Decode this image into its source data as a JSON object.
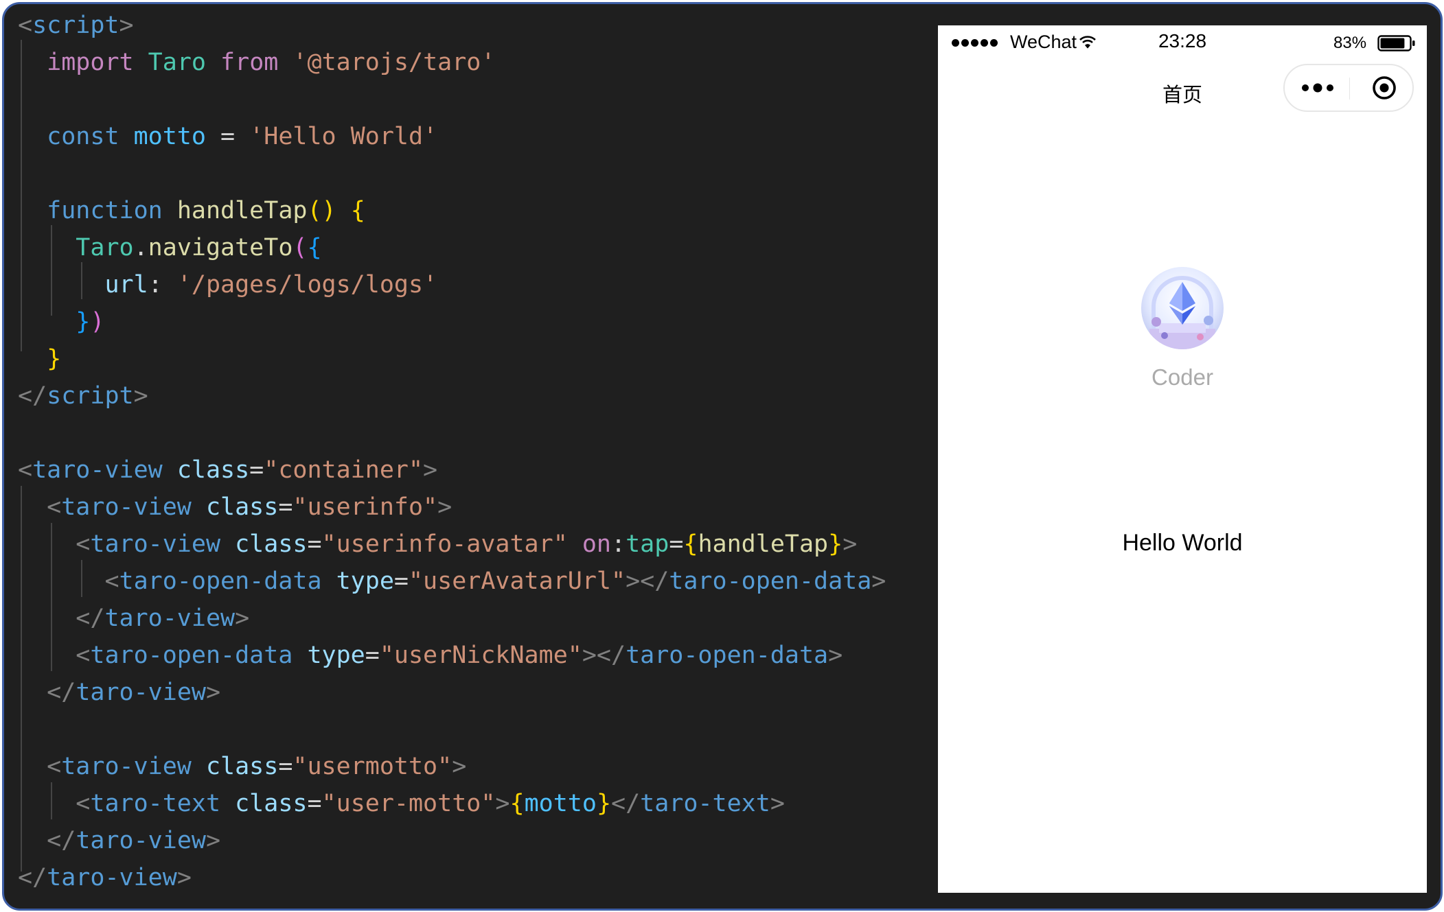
{
  "editor": {
    "lines": [
      [
        {
          "t": "<",
          "c": "t-tag"
        },
        {
          "t": "script",
          "c": "t-el"
        },
        {
          "t": ">",
          "c": "t-tag"
        }
      ],
      [
        {
          "t": "  "
        },
        {
          "t": "import",
          "c": "t-kw"
        },
        {
          "t": " "
        },
        {
          "t": "Taro",
          "c": "t-type"
        },
        {
          "t": " "
        },
        {
          "t": "from",
          "c": "t-kw"
        },
        {
          "t": " "
        },
        {
          "t": "'@tarojs/taro'",
          "c": "t-str"
        }
      ],
      [],
      [
        {
          "t": "  "
        },
        {
          "t": "const",
          "c": "t-decl"
        },
        {
          "t": " "
        },
        {
          "t": "motto",
          "c": "t-var"
        },
        {
          "t": " = ",
          "c": "t-plain"
        },
        {
          "t": "'Hello World'",
          "c": "t-str"
        }
      ],
      [],
      [
        {
          "t": "  "
        },
        {
          "t": "function",
          "c": "t-decl"
        },
        {
          "t": " "
        },
        {
          "t": "handleTap",
          "c": "t-fn"
        },
        {
          "t": "()",
          "c": "t-b1"
        },
        {
          "t": " "
        },
        {
          "t": "{",
          "c": "t-b1"
        }
      ],
      [
        {
          "t": "    "
        },
        {
          "t": "Taro",
          "c": "t-type"
        },
        {
          "t": ".",
          "c": "t-plain"
        },
        {
          "t": "navigateTo",
          "c": "t-fn"
        },
        {
          "t": "(",
          "c": "t-b2"
        },
        {
          "t": "{",
          "c": "t-b3"
        }
      ],
      [
        {
          "t": "      "
        },
        {
          "t": "url",
          "c": "t-prop"
        },
        {
          "t": ": ",
          "c": "t-plain"
        },
        {
          "t": "'/pages/logs/logs'",
          "c": "t-str"
        }
      ],
      [
        {
          "t": "    "
        },
        {
          "t": "}",
          "c": "t-b3"
        },
        {
          "t": ")",
          "c": "t-b2"
        }
      ],
      [
        {
          "t": "  "
        },
        {
          "t": "}",
          "c": "t-b1"
        }
      ],
      [
        {
          "t": "</",
          "c": "t-tag"
        },
        {
          "t": "script",
          "c": "t-el"
        },
        {
          "t": ">",
          "c": "t-tag"
        }
      ],
      [],
      [
        {
          "t": "<",
          "c": "t-tag"
        },
        {
          "t": "taro-view",
          "c": "t-el"
        },
        {
          "t": " "
        },
        {
          "t": "class",
          "c": "t-attr"
        },
        {
          "t": "=",
          "c": "t-plain"
        },
        {
          "t": "\"container\"",
          "c": "t-str"
        },
        {
          "t": ">",
          "c": "t-tag"
        }
      ],
      [
        {
          "t": "  "
        },
        {
          "t": "<",
          "c": "t-tag"
        },
        {
          "t": "taro-view",
          "c": "t-el"
        },
        {
          "t": " "
        },
        {
          "t": "class",
          "c": "t-attr"
        },
        {
          "t": "=",
          "c": "t-plain"
        },
        {
          "t": "\"userinfo\"",
          "c": "t-str"
        },
        {
          "t": ">",
          "c": "t-tag"
        }
      ],
      [
        {
          "t": "    "
        },
        {
          "t": "<",
          "c": "t-tag"
        },
        {
          "t": "taro-view",
          "c": "t-el"
        },
        {
          "t": " "
        },
        {
          "t": "class",
          "c": "t-attr"
        },
        {
          "t": "=",
          "c": "t-plain"
        },
        {
          "t": "\"userinfo-avatar\"",
          "c": "t-str"
        },
        {
          "t": " "
        },
        {
          "t": "on",
          "c": "t-kw"
        },
        {
          "t": ":",
          "c": "t-plain"
        },
        {
          "t": "tap",
          "c": "t-type"
        },
        {
          "t": "=",
          "c": "t-plain"
        },
        {
          "t": "{",
          "c": "t-b1"
        },
        {
          "t": "handleTap",
          "c": "t-fn"
        },
        {
          "t": "}",
          "c": "t-b1"
        },
        {
          "t": ">",
          "c": "t-tag"
        }
      ],
      [
        {
          "t": "      "
        },
        {
          "t": "<",
          "c": "t-tag"
        },
        {
          "t": "taro-open-data",
          "c": "t-el"
        },
        {
          "t": " "
        },
        {
          "t": "type",
          "c": "t-attr"
        },
        {
          "t": "=",
          "c": "t-plain"
        },
        {
          "t": "\"userAvatarUrl\"",
          "c": "t-str"
        },
        {
          "t": "></",
          "c": "t-tag"
        },
        {
          "t": "taro-open-data",
          "c": "t-el"
        },
        {
          "t": ">",
          "c": "t-tag"
        }
      ],
      [
        {
          "t": "    "
        },
        {
          "t": "</",
          "c": "t-tag"
        },
        {
          "t": "taro-view",
          "c": "t-el"
        },
        {
          "t": ">",
          "c": "t-tag"
        }
      ],
      [
        {
          "t": "    "
        },
        {
          "t": "<",
          "c": "t-tag"
        },
        {
          "t": "taro-open-data",
          "c": "t-el"
        },
        {
          "t": " "
        },
        {
          "t": "type",
          "c": "t-attr"
        },
        {
          "t": "=",
          "c": "t-plain"
        },
        {
          "t": "\"userNickName\"",
          "c": "t-str"
        },
        {
          "t": "></",
          "c": "t-tag"
        },
        {
          "t": "taro-open-data",
          "c": "t-el"
        },
        {
          "t": ">",
          "c": "t-tag"
        }
      ],
      [
        {
          "t": "  "
        },
        {
          "t": "</",
          "c": "t-tag"
        },
        {
          "t": "taro-view",
          "c": "t-el"
        },
        {
          "t": ">",
          "c": "t-tag"
        }
      ],
      [],
      [
        {
          "t": "  "
        },
        {
          "t": "<",
          "c": "t-tag"
        },
        {
          "t": "taro-view",
          "c": "t-el"
        },
        {
          "t": " "
        },
        {
          "t": "class",
          "c": "t-attr"
        },
        {
          "t": "=",
          "c": "t-plain"
        },
        {
          "t": "\"usermotto\"",
          "c": "t-str"
        },
        {
          "t": ">",
          "c": "t-tag"
        }
      ],
      [
        {
          "t": "    "
        },
        {
          "t": "<",
          "c": "t-tag"
        },
        {
          "t": "taro-text",
          "c": "t-el"
        },
        {
          "t": " "
        },
        {
          "t": "class",
          "c": "t-attr"
        },
        {
          "t": "=",
          "c": "t-plain"
        },
        {
          "t": "\"user-motto\"",
          "c": "t-str"
        },
        {
          "t": ">",
          "c": "t-tag"
        },
        {
          "t": "{",
          "c": "t-b1"
        },
        {
          "t": "motto",
          "c": "t-var"
        },
        {
          "t": "}",
          "c": "t-b1"
        },
        {
          "t": "</",
          "c": "t-tag"
        },
        {
          "t": "taro-text",
          "c": "t-el"
        },
        {
          "t": ">",
          "c": "t-tag"
        }
      ],
      [
        {
          "t": "  "
        },
        {
          "t": "</",
          "c": "t-tag"
        },
        {
          "t": "taro-view",
          "c": "t-el"
        },
        {
          "t": ">",
          "c": "t-tag"
        }
      ],
      [
        {
          "t": "</",
          "c": "t-tag"
        },
        {
          "t": "taro-view",
          "c": "t-el"
        },
        {
          "t": ">",
          "c": "t-tag"
        }
      ]
    ]
  },
  "phone": {
    "status_bar": {
      "carrier": "WeChat",
      "time": "23:28",
      "battery_percent": "83%",
      "battery_level": 0.83
    },
    "nav": {
      "title": "首页"
    },
    "user": {
      "nickname": "Coder"
    },
    "motto": "Hello World"
  }
}
